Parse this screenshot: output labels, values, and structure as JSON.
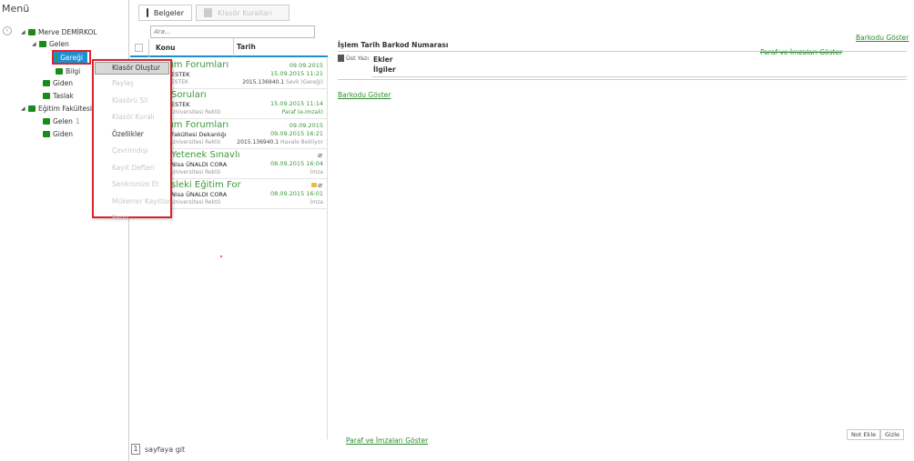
{
  "menu_title": "Menü",
  "collapse_icon": "‹",
  "tree": {
    "root": "Merve DEMİRKOL",
    "gelen": "Gelen",
    "geregi": "Gereği",
    "bilgi": "Bilgi",
    "giden": "Giden",
    "taslak": "Taslak",
    "fakulte": "Eğitim Fakültesi",
    "fakulte_gelen": "Gelen",
    "fakulte_gelen_count": "1",
    "fakulte_giden": "Giden"
  },
  "context_menu": [
    "Klasör Oluştur",
    "Paylaş",
    "Klasörü Sil",
    "Klasör Kuralı",
    "Özellikler",
    "Çevrimdışı",
    "Kayıt Defteri",
    "Senkronize Et",
    "Mükerrer Kayıtlar",
    "Pano"
  ],
  "tabs": {
    "belgeler": "Belgeler",
    "klasor_kurallari": "Klasör Kuralları"
  },
  "search": {
    "placeholder": "Ara..."
  },
  "list_header": {
    "konu": "Konu",
    "tarih": "Tarih"
  },
  "documents": [
    {
      "title": "ım Forumları",
      "from": "ESTEK",
      "org": "ESTEK",
      "date1": "09.09.2015",
      "date2": "15.09.2015 11:21",
      "status_no": "2015.136940.1",
      "status": "Sevk (Gereği)"
    },
    {
      "title": "Soruları",
      "from": "ESTEK",
      "org": "Üniversitesi Rektö",
      "date1": "",
      "date2": "15.09.2015 11:14",
      "status_no": "",
      "status": "Paraf (e-imzalı)"
    },
    {
      "title": "ım Forumları",
      "from": "Fakültesi Dekanlığı",
      "org": "Üniversitesi Rektö",
      "date1": "09.09.2015",
      "date2": "09.09.2015 16:21",
      "status_no": "2015.136940.1",
      "status": "Havale Bekliyor"
    },
    {
      "title": "Yetenek Sınavlı",
      "from": "Nisa ÜNALDI CORA",
      "org": "Üniversitesi Rektö",
      "date1": "",
      "date2": "08.09.2015 16:04",
      "status_no": "",
      "status": "İmza"
    },
    {
      "title": "sleki Eğitim For",
      "from": "Nisa ÜNALDI CORA",
      "org": "Üniversitesi Rektö",
      "date1": "",
      "date2": "08.09.2015 16:01",
      "status_no": "",
      "status": "İmza"
    }
  ],
  "pager": {
    "page": "1",
    "label": "sayfaya git"
  },
  "detail": {
    "header": "İşlem Tarih Barkod Numarası",
    "barkodu_goster_top": "Barkodu Göster",
    "paraf_imzalar_top": "Paraf ve İmzaları Göster",
    "ust_yazi": "Üst Yazı",
    "ekler": "Ekler",
    "ilgiler": "İlgiler",
    "barkodu_goster_mid": "Barkodu Göster",
    "paraf_imzalar_bottom": "Paraf ve İmzaları Göster",
    "not_ekle": "Not Ekle",
    "gizle": "Gizle"
  },
  "colors": {
    "accent": "#1e8fd0",
    "folder": "#1b8a1b",
    "link": "#2e8b2e",
    "highlight_box": "#d9262d"
  }
}
